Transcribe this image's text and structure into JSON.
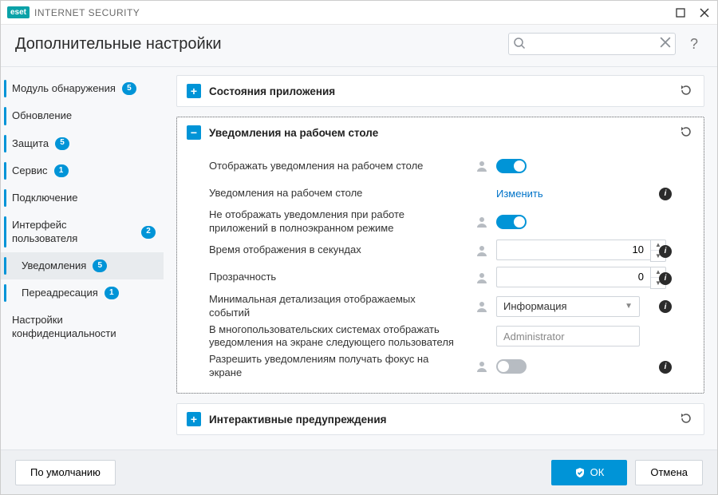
{
  "window": {
    "brand_badge": "eset",
    "brand_name": "INTERNET SECURITY"
  },
  "header": {
    "title": "Дополнительные настройки",
    "search_placeholder": "",
    "help_label": "?"
  },
  "sidebar": {
    "items": [
      {
        "label": "Модуль обнаружения",
        "badge": "5",
        "bar": true,
        "active": false
      },
      {
        "label": "Обновление",
        "badge": null,
        "bar": true,
        "active": false
      },
      {
        "label": "Защита",
        "badge": "5",
        "bar": true,
        "active": false
      },
      {
        "label": "Сервис",
        "badge": "1",
        "bar": true,
        "active": false
      },
      {
        "label": "Подключение",
        "badge": null,
        "bar": true,
        "active": false
      },
      {
        "label": "Интерфейс пользователя",
        "badge": "2",
        "bar": true,
        "active": false
      },
      {
        "label": "Уведомления",
        "badge": "5",
        "bar": true,
        "active": true,
        "sub": true
      },
      {
        "label": "Переадресация",
        "badge": "1",
        "bar": true,
        "active": false,
        "sub": true
      },
      {
        "label": "Настройки конфиденциальности",
        "badge": null,
        "bar": false,
        "active": false
      }
    ]
  },
  "panels": {
    "app_states": {
      "title": "Состояния приложения",
      "expanded": false
    },
    "desktop_notifications": {
      "title": "Уведомления на рабочем столе",
      "expanded": true,
      "rows": {
        "show_on_desktop": {
          "label": "Отображать уведомления на рабочем столе",
          "toggle": true
        },
        "desktop_notifications": {
          "label": "Уведомления на рабочем столе",
          "link": "Изменить"
        },
        "hide_fullscreen": {
          "label": "Не отображать уведомления при работе приложений в полноэкранном режиме",
          "toggle": true
        },
        "display_seconds": {
          "label": "Время отображения в секундах",
          "value": "10"
        },
        "transparency": {
          "label": "Прозрачность",
          "value": "0"
        },
        "min_detail": {
          "label": "Минимальная детализация отображаемых событий",
          "value": "Информация"
        },
        "multiuser": {
          "label": "В многопользовательских системах отображать уведомления на экране следующего пользователя",
          "value": "Administrator"
        },
        "allow_focus": {
          "label": "Разрешить уведомлениям получать фокус на экране",
          "toggle": false
        }
      }
    },
    "interactive_alerts": {
      "title": "Интерактивные предупреждения",
      "expanded": false
    }
  },
  "footer": {
    "defaults": "По умолчанию",
    "ok": "ОК",
    "cancel": "Отмена"
  }
}
